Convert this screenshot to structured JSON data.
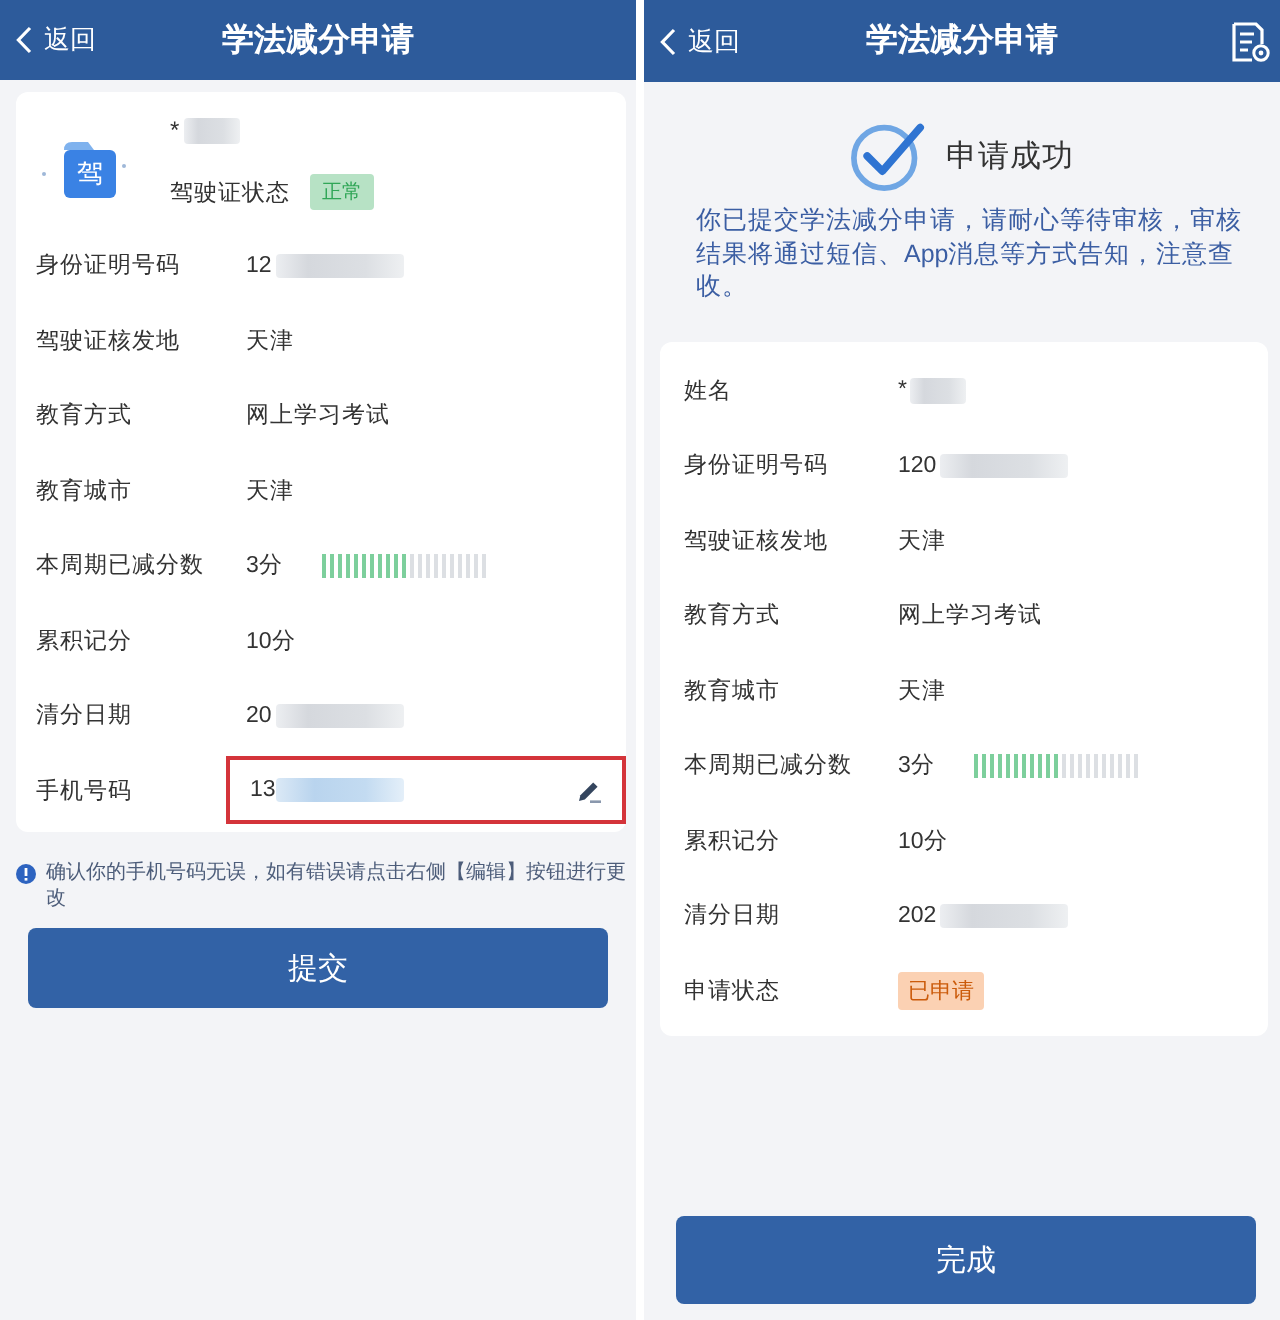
{
  "screens": [
    {
      "kind": "form",
      "header": {
        "back_label": "返回",
        "title": "学法减分申请",
        "doc_icon": false
      },
      "profile": {
        "icon_text": "驾",
        "name": "*",
        "name_redacted": true,
        "status_label": "驾驶证状态",
        "status_tag": {
          "text": "正常",
          "color": "#b7e2c5"
        }
      },
      "rows": [
        {
          "kind": "text",
          "label": "身份证明号码",
          "value": "12",
          "redacted": true
        },
        {
          "kind": "text",
          "label": "驾驶证核发地",
          "value": "天津",
          "redacted": false
        },
        {
          "kind": "text",
          "label": "教育方式",
          "value": "网上学习考试",
          "redacted": false
        },
        {
          "kind": "text",
          "label": "教育城市",
          "value": "天津",
          "redacted": false
        },
        {
          "kind": "progress",
          "label": "本周期已减分数",
          "value": "3分",
          "level": 0.5,
          "redacted": false
        },
        {
          "kind": "text",
          "label": "累积记分",
          "value": "10分",
          "redacted": false
        },
        {
          "kind": "text",
          "label": "清分日期",
          "value": "20",
          "redacted": true
        },
        {
          "kind": "field",
          "label": "手机号码",
          "value": "13",
          "redacted": true,
          "highlighted": true
        }
      ],
      "note": "确认你的手机号码无误，如有错误请点击右侧【编辑】按钮进行更改",
      "button": "提交"
    },
    {
      "kind": "result",
      "header": {
        "back_label": "返回",
        "title": "学法减分申请",
        "doc_icon": true
      },
      "success": {
        "title": "申请成功",
        "message": "你已提交学法减分申请，请耐心等待审核，审核结果将通过短信、App消息等方式告知，注意查收。"
      },
      "rows": [
        {
          "kind": "text",
          "label": "姓名",
          "value": "*",
          "redacted": true
        },
        {
          "kind": "text",
          "label": "身份证明号码",
          "value": "120",
          "redacted": true
        },
        {
          "kind": "text",
          "label": "驾驶证核发地",
          "value": "天津",
          "redacted": false
        },
        {
          "kind": "text",
          "label": "教育方式",
          "value": "网上学习考试",
          "redacted": false
        },
        {
          "kind": "text",
          "label": "教育城市",
          "value": "天津",
          "redacted": false
        },
        {
          "kind": "progress",
          "label": "本周期已减分数",
          "value": "3分",
          "level": 0.5,
          "redacted": false
        },
        {
          "kind": "text",
          "label": "累积记分",
          "value": "10分",
          "redacted": false
        },
        {
          "kind": "text",
          "label": "清分日期",
          "value": "202",
          "redacted": true
        },
        {
          "kind": "tag",
          "label": "申请状态",
          "value": "已申请",
          "color": "#fbd1b3",
          "redacted": false
        }
      ],
      "button": "完成"
    }
  ]
}
